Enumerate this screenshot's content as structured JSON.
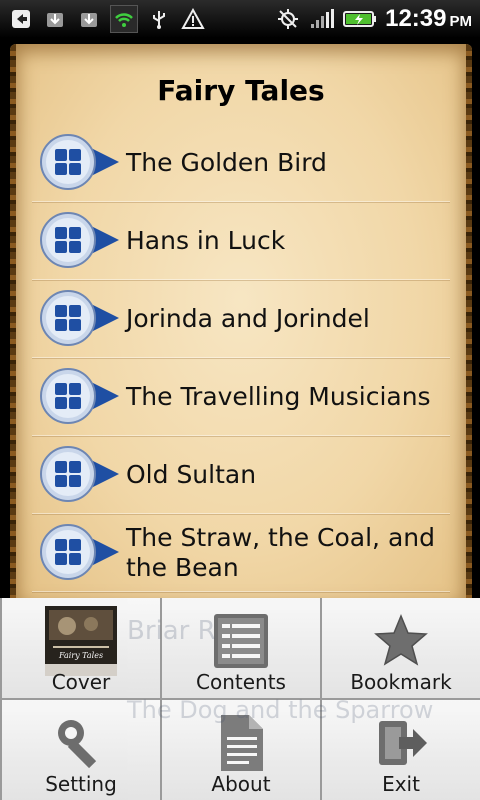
{
  "status_bar": {
    "time": "12:39",
    "ampm": "PM"
  },
  "page": {
    "title": "Fairy Tales"
  },
  "stories": [
    {
      "label": "The Golden Bird"
    },
    {
      "label": "Hans in Luck"
    },
    {
      "label": "Jorinda and Jorindel"
    },
    {
      "label": "The Travelling Musicians"
    },
    {
      "label": "Old Sultan"
    },
    {
      "label": "The Straw, the Coal, and the Bean"
    }
  ],
  "hidden_items": {
    "item7": "Briar R",
    "item8": "The Dog and the Sparrow"
  },
  "menu": {
    "cover": "Cover",
    "contents": "Contents",
    "bookmark": "Bookmark",
    "setting": "Setting",
    "about": "About",
    "exit": "Exit",
    "cover_art_text": "Fairy Tales"
  },
  "colors": {
    "parchment": "#f1d7a7",
    "icon_blue": "#1f4fa3"
  }
}
